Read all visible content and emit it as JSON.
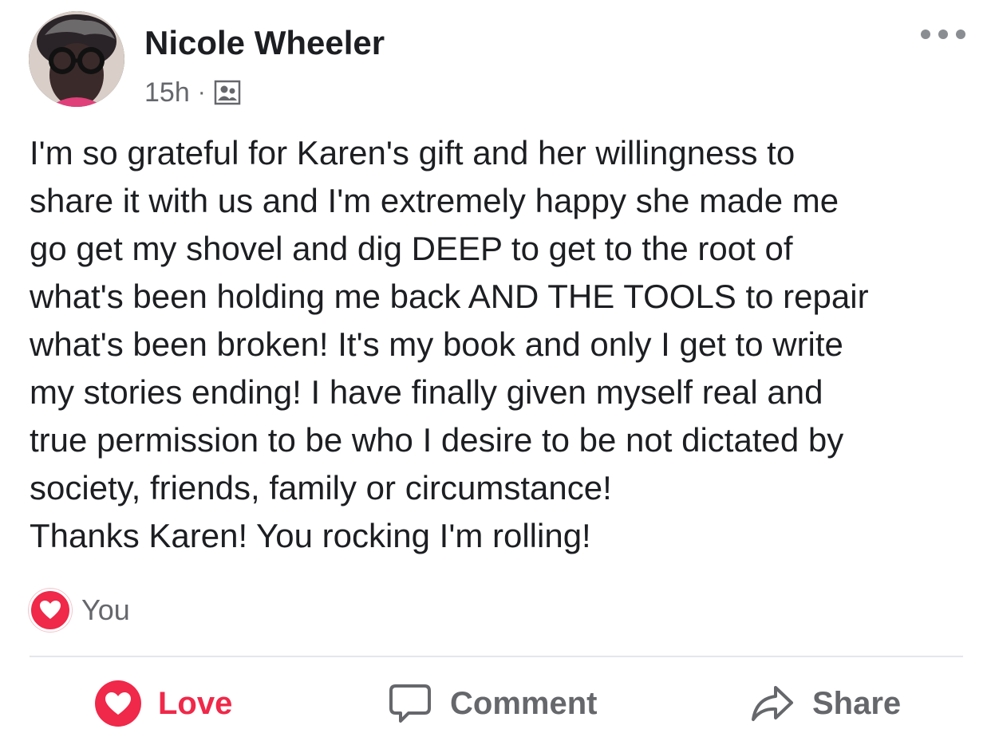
{
  "post": {
    "author": "Nicole Wheeler",
    "time": "15h",
    "separator": "·",
    "audience_icon": "friends-group-icon",
    "more_icon": "more-options-icon",
    "text_lines": [
      "I'm so grateful for Karen's gift and her willingness to",
      "share it with us and I'm extremely happy she made me",
      "go get my shovel and dig DEEP to get to the root of",
      "what's been holding me back AND THE TOOLS to repair",
      "what's been broken! It's my book and only I get to write",
      "my stories ending! I have finally given myself real and",
      "true permission to be who I desire to be not dictated by",
      "society, friends, family or circumstance!",
      "Thanks Karen!  You rocking I'm rolling!"
    ]
  },
  "reactions": {
    "icon": "heart-love-icon",
    "summary": "You"
  },
  "actions": {
    "love": {
      "label": "Love",
      "icon": "heart-love-icon",
      "active": true
    },
    "comment": {
      "label": "Comment",
      "icon": "comment-bubble-icon"
    },
    "share": {
      "label": "Share",
      "icon": "share-arrow-icon"
    }
  },
  "colors": {
    "love_red": "#f02849",
    "secondary_text": "#65676b",
    "primary_text": "#1c1e21",
    "divider": "#e4e6eb"
  }
}
